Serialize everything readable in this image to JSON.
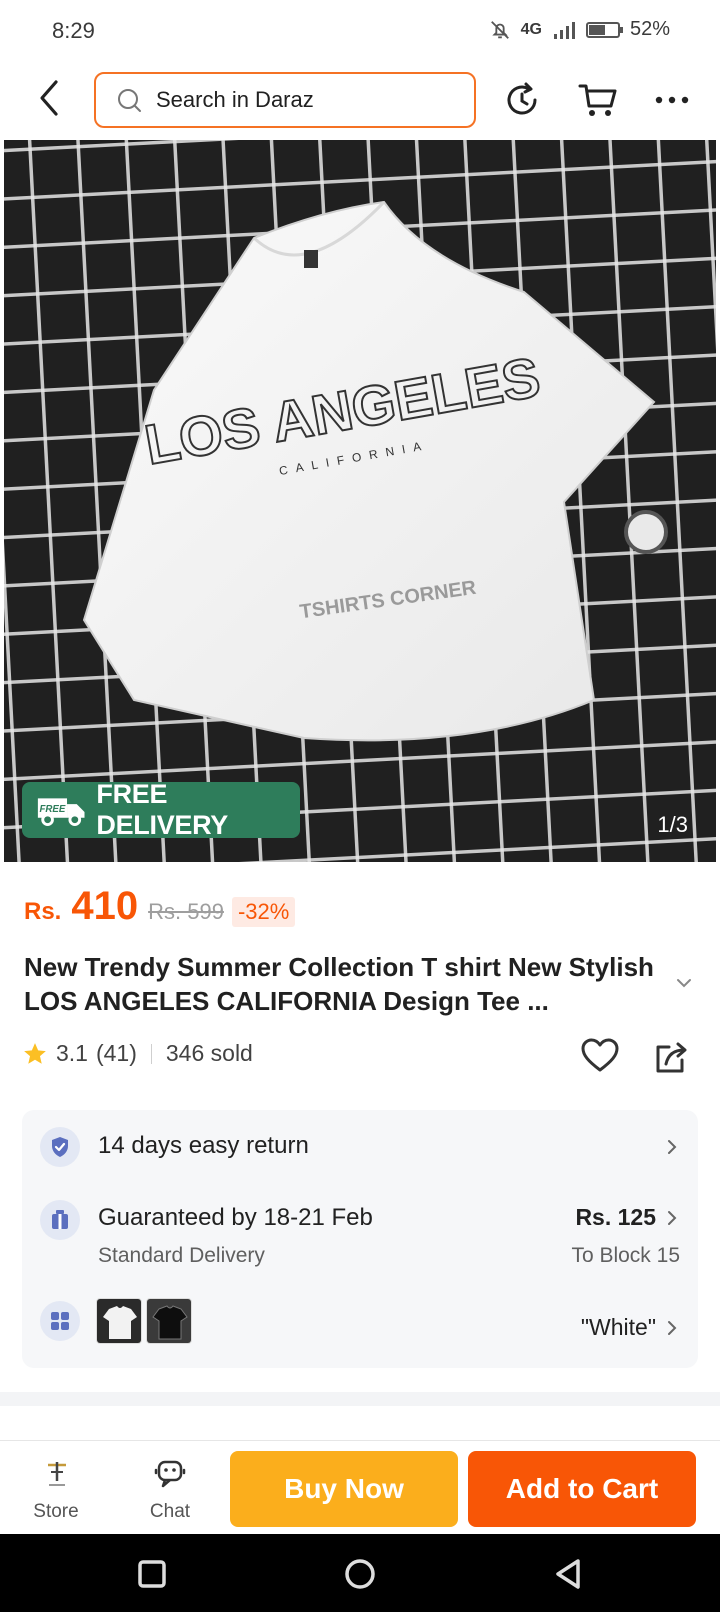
{
  "status_bar": {
    "time": "8:29",
    "network": "4G",
    "battery_percent": "52%",
    "battery_level": 0.52
  },
  "header": {
    "search_placeholder": "Search in Daraz"
  },
  "gallery": {
    "shirt_text_main": "LOS ANGELES",
    "shirt_text_sub": "CALIFORNIA",
    "watermark": "TSHIRTS CORNER",
    "badge_icon_text": "FREE",
    "badge_label": "FREE DELIVERY",
    "counter": "1/3"
  },
  "price": {
    "currency": "Rs.",
    "current": "410",
    "original": "Rs. 599",
    "discount": "-32%"
  },
  "product": {
    "title": "New Trendy Summer Collection T shirt New Stylish LOS ANGELES CALIFORNIA Design Tee ..."
  },
  "rating": {
    "score": "3.1",
    "count": "(41)",
    "sold": "346 sold"
  },
  "info": {
    "return": {
      "label": "14 days easy return"
    },
    "delivery": {
      "label": "Guaranteed by 18-21 Feb",
      "sub": "Standard Delivery",
      "fee": "Rs. 125",
      "location": "To Block 15"
    },
    "variant": {
      "selected": "\"White\""
    }
  },
  "bottom_bar": {
    "store_label": "Store",
    "chat_label": "Chat",
    "buy_now": "Buy Now",
    "add_to_cart": "Add to Cart"
  },
  "colors": {
    "brand_orange": "#f85606",
    "buy_yellow": "#fbae1c",
    "badge_green": "#2e7d5b"
  }
}
